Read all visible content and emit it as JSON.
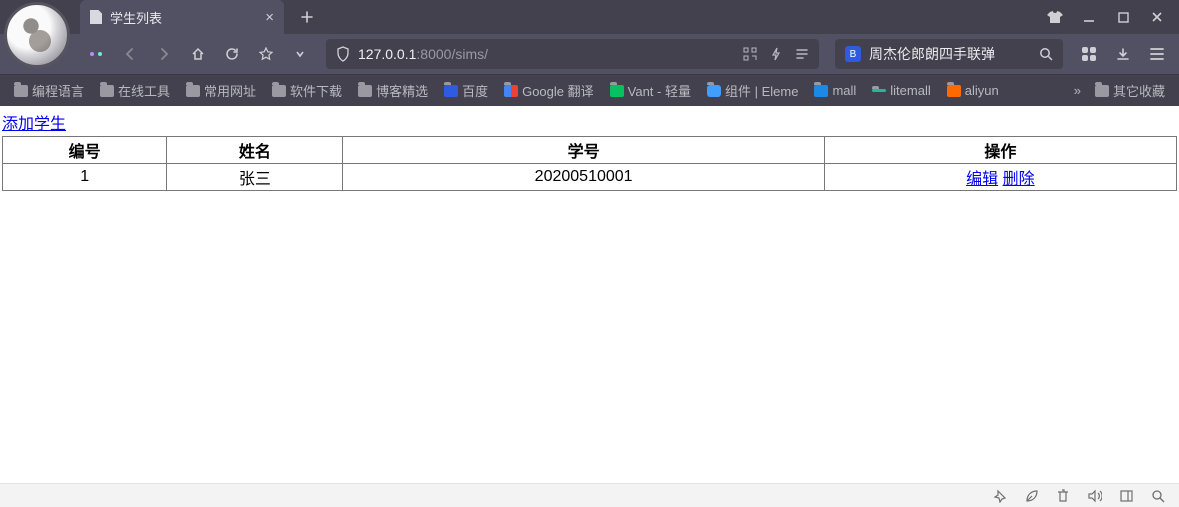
{
  "browser": {
    "tab_title": "学生列表",
    "url": {
      "prefix": "127.0.0.1",
      "port": ":8000",
      "path": "/sims/"
    },
    "search_placeholder": "周杰伦郎朗四手联弹",
    "bookmarks": [
      {
        "label": "编程语言",
        "icon": "folder"
      },
      {
        "label": "在线工具",
        "icon": "folder"
      },
      {
        "label": "常用网址",
        "icon": "folder"
      },
      {
        "label": "软件下载",
        "icon": "folder"
      },
      {
        "label": "博客精选",
        "icon": "folder"
      },
      {
        "label": "百度",
        "icon": "baidu"
      },
      {
        "label": "Google 翻译",
        "icon": "google"
      },
      {
        "label": "Vant - 轻量",
        "icon": "vant"
      },
      {
        "label": "组件 | Eleme",
        "icon": "eleme"
      },
      {
        "label": "mall",
        "icon": "mall"
      },
      {
        "label": "litemall",
        "icon": "lite"
      },
      {
        "label": "aliyun",
        "icon": "ali"
      }
    ],
    "overflow_label": "»",
    "other_folder": "其它收藏"
  },
  "page": {
    "add_link": "添加学生",
    "columns": {
      "id": "编号",
      "name": "姓名",
      "sno": "学号",
      "ops": "操作"
    },
    "rows": [
      {
        "id": "1",
        "name": "张三",
        "sno": "20200510001"
      }
    ],
    "ops": {
      "edit": "编辑",
      "delete": "删除"
    }
  }
}
